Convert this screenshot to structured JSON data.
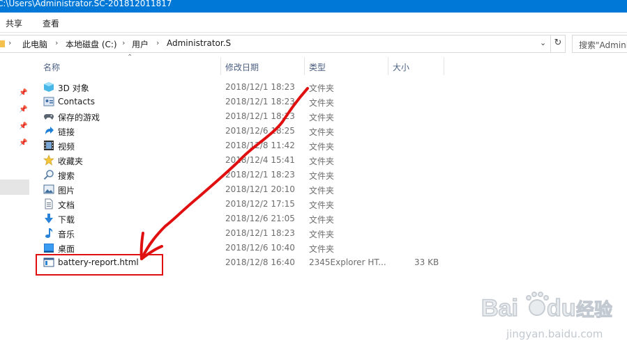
{
  "window": {
    "title": "C:\\Users\\Administrator.SC-201812011817"
  },
  "ribbon": {
    "tabs": [
      "共享",
      "查看"
    ]
  },
  "address": {
    "crumbs": [
      "此电脑",
      "本地磁盘 (C:)",
      "用户",
      "Administrator.SC"
    ],
    "search_placeholder": "搜索\"Admini"
  },
  "columns": {
    "name": "名称",
    "date": "修改日期",
    "type": "类型",
    "size": "大小"
  },
  "files": [
    {
      "name": "3D 对象",
      "date": "2018/12/1 18:23",
      "type": "文件夹",
      "size": "",
      "icon": "3d-objects-icon"
    },
    {
      "name": "Contacts",
      "date": "2018/12/1 18:23",
      "type": "文件夹",
      "size": "",
      "icon": "contacts-icon"
    },
    {
      "name": "保存的游戏",
      "date": "2018/12/1 18:23",
      "type": "文件夹",
      "size": "",
      "icon": "saved-games-icon"
    },
    {
      "name": "链接",
      "date": "2018/12/6 18:25",
      "type": "文件夹",
      "size": "",
      "icon": "links-icon"
    },
    {
      "name": "视频",
      "date": "2018/12/8 11:42",
      "type": "文件夹",
      "size": "",
      "icon": "videos-icon"
    },
    {
      "name": "收藏夹",
      "date": "2018/12/4 15:41",
      "type": "文件夹",
      "size": "",
      "icon": "favorites-icon"
    },
    {
      "name": "搜索",
      "date": "2018/12/1 18:23",
      "type": "文件夹",
      "size": "",
      "icon": "searches-icon"
    },
    {
      "name": "图片",
      "date": "2018/12/1 20:10",
      "type": "文件夹",
      "size": "",
      "icon": "pictures-icon"
    },
    {
      "name": "文档",
      "date": "2018/12/2 17:15",
      "type": "文件夹",
      "size": "",
      "icon": "documents-icon"
    },
    {
      "name": "下载",
      "date": "2018/12/6 21:05",
      "type": "文件夹",
      "size": "",
      "icon": "downloads-icon"
    },
    {
      "name": "音乐",
      "date": "2018/12/1 18:23",
      "type": "文件夹",
      "size": "",
      "icon": "music-icon"
    },
    {
      "name": "桌面",
      "date": "2018/12/6 10:40",
      "type": "文件夹",
      "size": "",
      "icon": "desktop-icon"
    },
    {
      "name": "battery-report.html",
      "date": "2018/12/8 16:40",
      "type": "2345Explorer HT...",
      "size": "33 KB",
      "icon": "html-file-icon"
    }
  ],
  "watermark": {
    "brand": "Baidu",
    "brand_cn": "经验",
    "url": "jingyan.baidu.com"
  },
  "colors": {
    "titlebar": "#0078d7",
    "annotation": "#e01010",
    "header_text": "#4d6082"
  }
}
